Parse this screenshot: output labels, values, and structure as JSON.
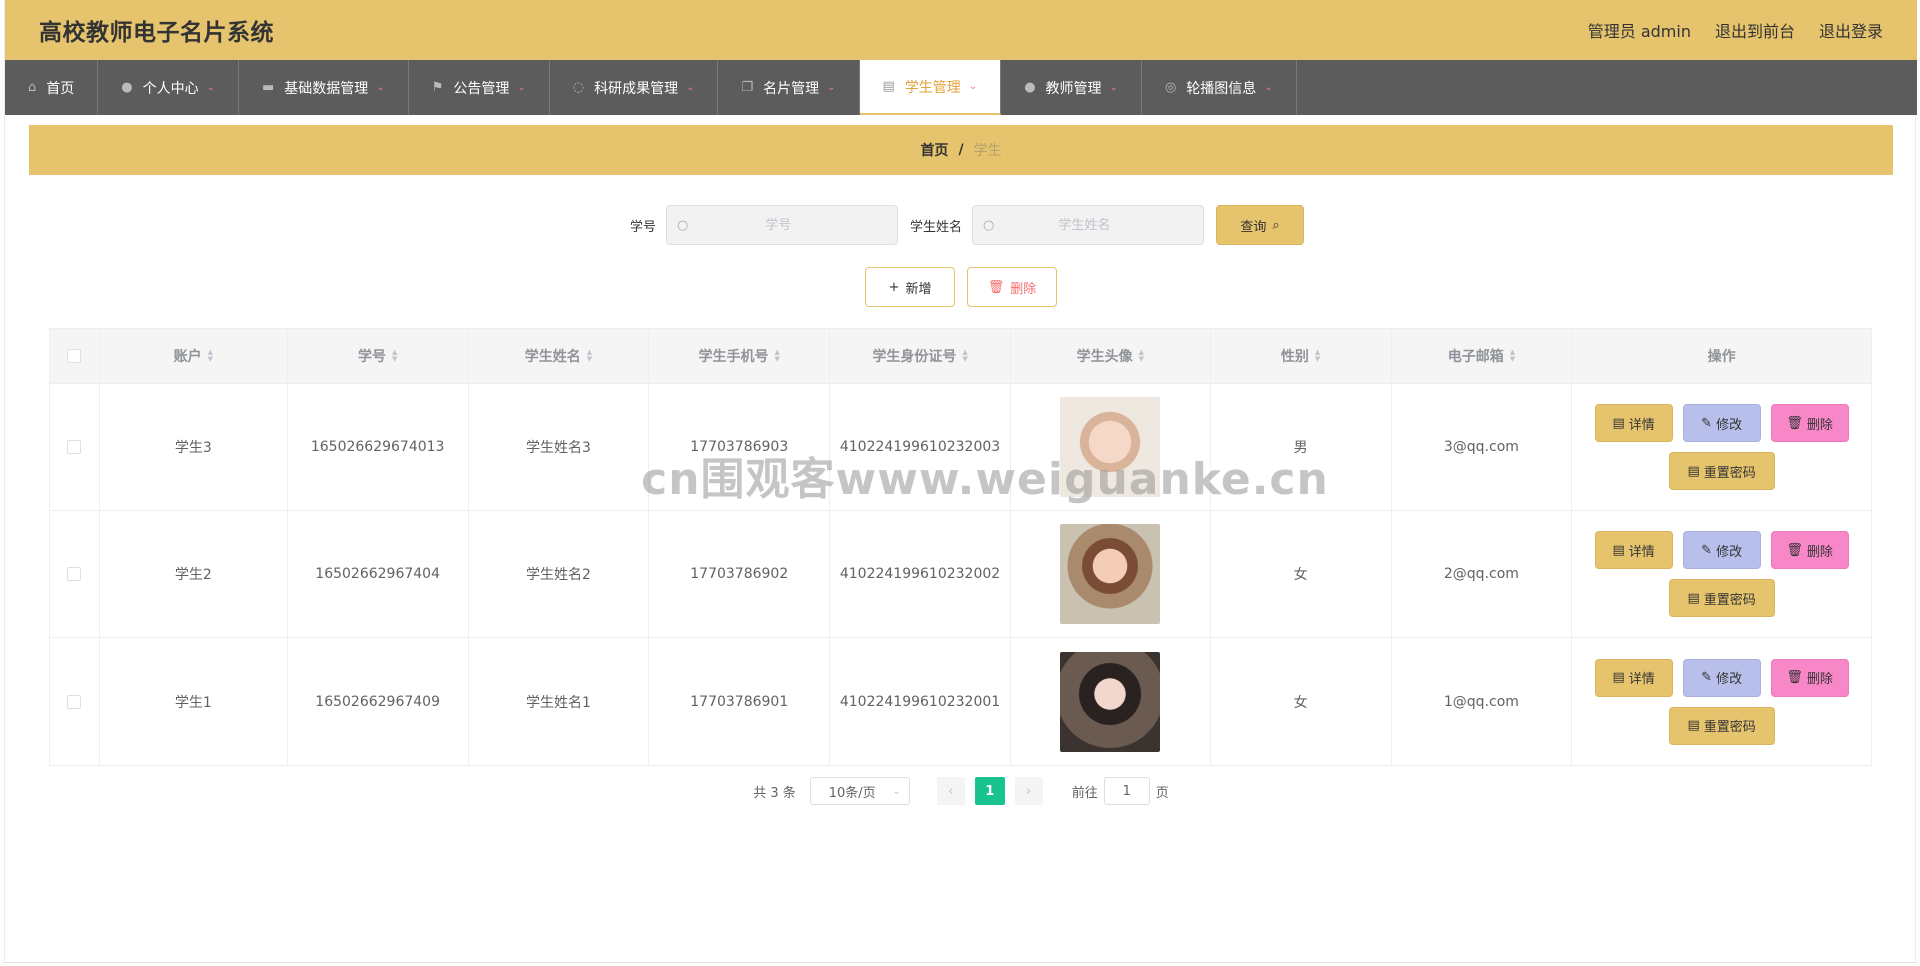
{
  "header": {
    "title": "高校教师电子名片系统",
    "admin": "管理员 admin",
    "to_front": "退出到前台",
    "logout": "退出登录"
  },
  "nav": {
    "items": [
      {
        "label": "首页",
        "icon": "home-icon",
        "dropdown": false
      },
      {
        "label": "个人中心",
        "icon": "user-icon",
        "dropdown": true
      },
      {
        "label": "基础数据管理",
        "icon": "chat-icon",
        "dropdown": true
      },
      {
        "label": "公告管理",
        "icon": "flag-icon",
        "dropdown": true
      },
      {
        "label": "科研成果管理",
        "icon": "power-icon",
        "dropdown": true
      },
      {
        "label": "名片管理",
        "icon": "copy-icon",
        "dropdown": true
      },
      {
        "label": "学生管理",
        "icon": "clipboard-icon",
        "dropdown": true,
        "active": true
      },
      {
        "label": "教师管理",
        "icon": "user-icon",
        "dropdown": true
      },
      {
        "label": "轮播图信息",
        "icon": "target-icon",
        "dropdown": true
      }
    ]
  },
  "breadcrumb": {
    "home": "首页",
    "separator": "/",
    "current": "学生"
  },
  "search": {
    "student_no_label": "学号",
    "student_no_placeholder": "学号",
    "student_name_label": "学生姓名",
    "student_name_placeholder": "学生姓名",
    "query_button": "查询"
  },
  "actions": {
    "add": "新增",
    "delete": "删除"
  },
  "table": {
    "headers": [
      "账户",
      "学号",
      "学生姓名",
      "学生手机号",
      "学生身份证号",
      "学生头像",
      "性别",
      "电子邮箱",
      "操作"
    ],
    "rows": [
      {
        "account": "学生3",
        "no": "165026629674013",
        "name": "学生姓名3",
        "phone": "17703786903",
        "idcard": "410224199610232003",
        "gender": "男",
        "email": "3@qq.com"
      },
      {
        "account": "学生2",
        "no": "16502662967404",
        "name": "学生姓名2",
        "phone": "17703786902",
        "idcard": "410224199610232002",
        "gender": "女",
        "email": "2@qq.com"
      },
      {
        "account": "学生1",
        "no": "16502662967409",
        "name": "学生姓名1",
        "phone": "17703786901",
        "idcard": "410224199610232001",
        "gender": "女",
        "email": "1@qq.com"
      }
    ],
    "ops": {
      "detail": "详情",
      "edit": "修改",
      "delete": "删除",
      "reset": "重置密码"
    }
  },
  "pagination": {
    "total": "共 3 条",
    "page_size": "10条/页",
    "current_page": "1",
    "goto_prefix": "前往",
    "goto_value": "1",
    "goto_suffix": "页"
  },
  "watermark": "cn围观客www.weiguanke.cn",
  "colors": {
    "header_bg": "#e6c46e",
    "nav_bg": "#5c5c5c",
    "active_page": "#19c38f",
    "edit_btn": "#b8bfea",
    "delete_btn": "#f887c8"
  }
}
